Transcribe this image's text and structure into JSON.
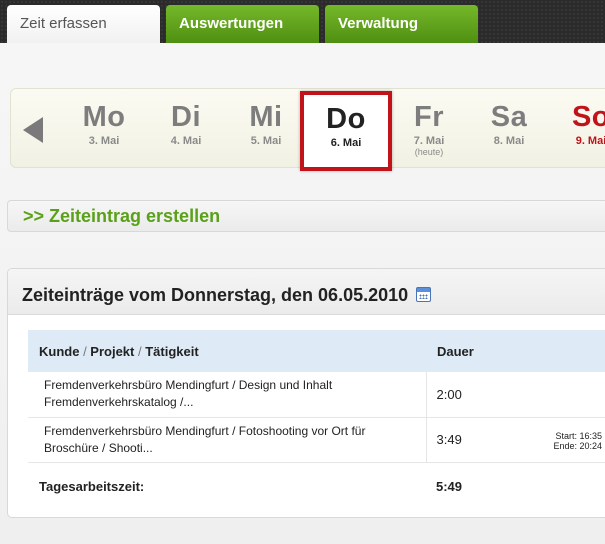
{
  "tabs": [
    {
      "label": "Zeit erfassen"
    },
    {
      "label": "Auswertungen"
    },
    {
      "label": "Verwaltung"
    }
  ],
  "days": [
    {
      "name": "Mo",
      "date": "3. Mai"
    },
    {
      "name": "Di",
      "date": "4. Mai"
    },
    {
      "name": "Mi",
      "date": "5. Mai"
    },
    {
      "name": "Do",
      "date": "6. Mai"
    },
    {
      "name": "Fr",
      "date": "7. Mai",
      "note": "(heute)"
    },
    {
      "name": "Sa",
      "date": "8. Mai"
    },
    {
      "name": "So",
      "date": "9. Mai"
    }
  ],
  "create_entry": ">> Zeiteintrag erstellen",
  "entries_panel": {
    "title": "Zeiteinträge vom Donnerstag, den 06.05.2010",
    "columns": {
      "kunde": "Kunde",
      "sep1": " / ",
      "projekt": "Projekt",
      "sep2": " / ",
      "taetigkeit": "Tätigkeit",
      "dauer": "Dauer"
    },
    "rows": [
      {
        "line1": "Fremdenverkehrsbüro Mendingfurt / Design und Inhalt",
        "line2": "Fremdenverkehrskatalog /...",
        "duration": "2:00"
      },
      {
        "line1": "Fremdenverkehrsbüro Mendingfurt / Fotoshooting vor Ort für",
        "line2": "Broschüre / Shooti...",
        "duration": "3:49",
        "start": "Start: 16:35",
        "end": "Ende: 20:24"
      }
    ],
    "total_label": "Tagesarbeitszeit:",
    "total_value": "5:49"
  },
  "colors": {
    "accent_green": "#5aa019",
    "selected_red": "#c0141a",
    "header_blue": "#deebf6"
  }
}
